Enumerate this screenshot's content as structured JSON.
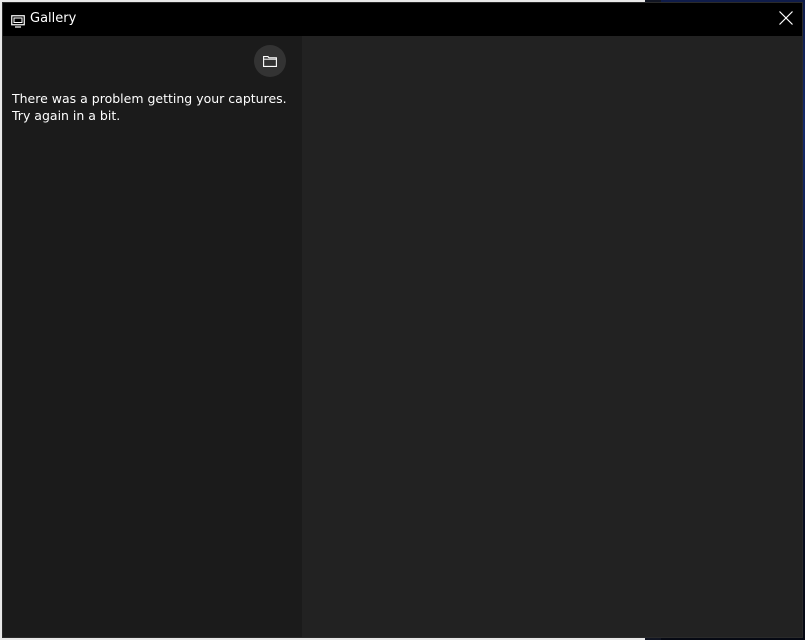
{
  "window": {
    "title": "Gallery",
    "title_icon": "gallery-icon",
    "close_icon": "close-icon"
  },
  "left_pane": {
    "open_folder_icon": "folder-icon",
    "message_line1": "There was a problem getting your captures.",
    "message_line2": "Try again in a bit."
  },
  "colors": {
    "titlebar": "#000000",
    "left_pane": "#1b1b1b",
    "right_pane": "#222222",
    "folder_button": "#333333",
    "text": "#ffffff"
  }
}
